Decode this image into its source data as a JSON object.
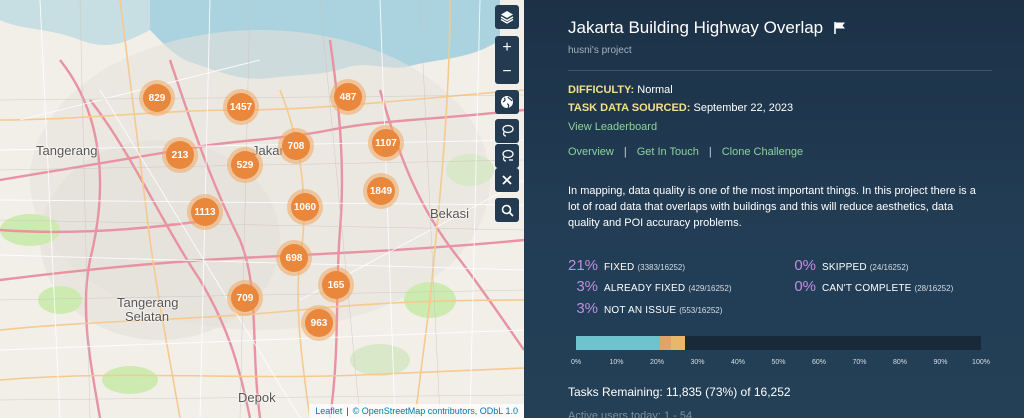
{
  "map": {
    "places": [
      {
        "id": "tangerang",
        "label": "Tangerang"
      },
      {
        "id": "jakarta",
        "label": "Jakarta"
      },
      {
        "id": "bekasi",
        "label": "Bekasi"
      },
      {
        "id": "tangerang-selatan-1",
        "label": "Tangerang"
      },
      {
        "id": "tangerang-selatan-2",
        "label": "Selatan"
      },
      {
        "id": "depok",
        "label": "Depok"
      }
    ],
    "clusters": [
      {
        "count": "829"
      },
      {
        "count": "1457"
      },
      {
        "count": "487"
      },
      {
        "count": "708"
      },
      {
        "count": "1107"
      },
      {
        "count": "213"
      },
      {
        "count": "529"
      },
      {
        "count": "1849"
      },
      {
        "count": "1113"
      },
      {
        "count": "1060"
      },
      {
        "count": "698"
      },
      {
        "count": "165"
      },
      {
        "count": "709"
      },
      {
        "count": "963"
      }
    ],
    "controls": {
      "layers": "layers-icon",
      "zoom_in": "+",
      "zoom_out": "−",
      "globe": "globe-icon",
      "lasso_select": "lasso-icon",
      "lasso_deselect": "lasso-minus-icon",
      "clear": "×",
      "search": "search-icon"
    },
    "attribution": {
      "leaflet": "Leaflet",
      "sep": "|",
      "osm": "© OpenStreetMap contributors, ODbL 1.0"
    }
  },
  "challenge": {
    "title": "Jakarta Building Highway Overlap",
    "owner": "husni's project",
    "difficulty_label": "DIFFICULTY:",
    "difficulty_value": "Normal",
    "sourced_label": "TASK DATA SOURCED:",
    "sourced_value": "September 22, 2023",
    "leaderboard_link": "View Leaderboard",
    "links": {
      "overview": "Overview",
      "sep1": "|",
      "contact": "Get In Touch",
      "sep2": "|",
      "clone": "Clone Challenge"
    },
    "description": "In mapping, data quality is one of the most important things. In this project there is a lot of road data that overlaps with buildings and this will reduce aesthetics, data quality and POI accuracy problems."
  },
  "stats": [
    {
      "pct": "21%",
      "label": "FIXED",
      "count": "(3383/16252)"
    },
    {
      "pct": "3%",
      "label": "ALREADY FIXED",
      "count": "(429/16252)"
    },
    {
      "pct": "3%",
      "label": "NOT AN ISSUE",
      "count": "(553/16252)"
    },
    {
      "pct": "0%",
      "label": "SKIPPED",
      "count": "(24/16252)"
    },
    {
      "pct": "0%",
      "label": "CAN'T COMPLETE",
      "count": "(28/16252)"
    }
  ],
  "progress": {
    "fixed": 0.208,
    "already_fixed": 0.026,
    "not_an_issue": 0.034,
    "colors": {
      "fixed": "#6fc3ce",
      "already_fixed": "#e0a46a",
      "not_an_issue": "#e7b76a",
      "remaining": "#18293a"
    },
    "ticks": [
      "0%",
      "10%",
      "20%",
      "30%",
      "40%",
      "50%",
      "60%",
      "70%",
      "80%",
      "90%",
      "100%"
    ]
  },
  "tasks_remaining": "Tasks Remaining: 11,835 (73%) of 16,252",
  "faded_text": "Active users today: 1 - 54"
}
